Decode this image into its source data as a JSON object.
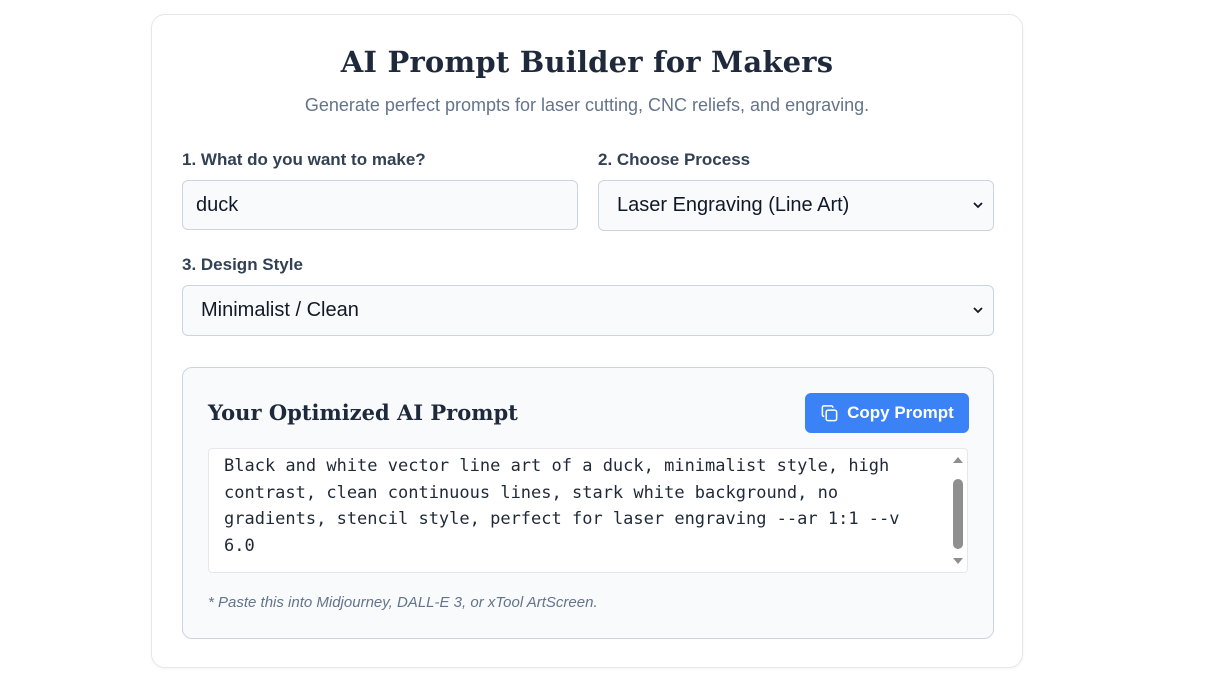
{
  "header": {
    "title": "AI Prompt Builder for Makers",
    "subtitle": "Generate perfect prompts for laser cutting, CNC reliefs, and engraving."
  },
  "form": {
    "make_label": "1. What do you want to make?",
    "make_value": "duck",
    "process_label": "2. Choose Process",
    "process_value": "Laser Engraving (Line Art)",
    "style_label": "3. Design Style",
    "style_value": "Minimalist / Clean"
  },
  "output": {
    "title": "Your Optimized AI Prompt",
    "copy_label": "Copy Prompt",
    "prompt_text": "Black and white vector line art of a duck, minimalist style, high contrast, clean continuous lines, stark white background, no gradients, stencil style, perfect for laser engraving --ar 1:1 --v 6.0",
    "note": "* Paste this into Midjourney, DALL-E 3, or xTool ArtScreen."
  },
  "colors": {
    "accent": "#3b82f6",
    "title_text": "#1e293b",
    "muted_text": "#64748b",
    "field_bg": "#f8fafc",
    "border": "#cbd5e1"
  },
  "icons": {
    "copy": "copy-icon",
    "select_arrow": "chevron-down-icon",
    "scroll_up": "scroll-up-icon",
    "scroll_down": "scroll-down-icon"
  }
}
